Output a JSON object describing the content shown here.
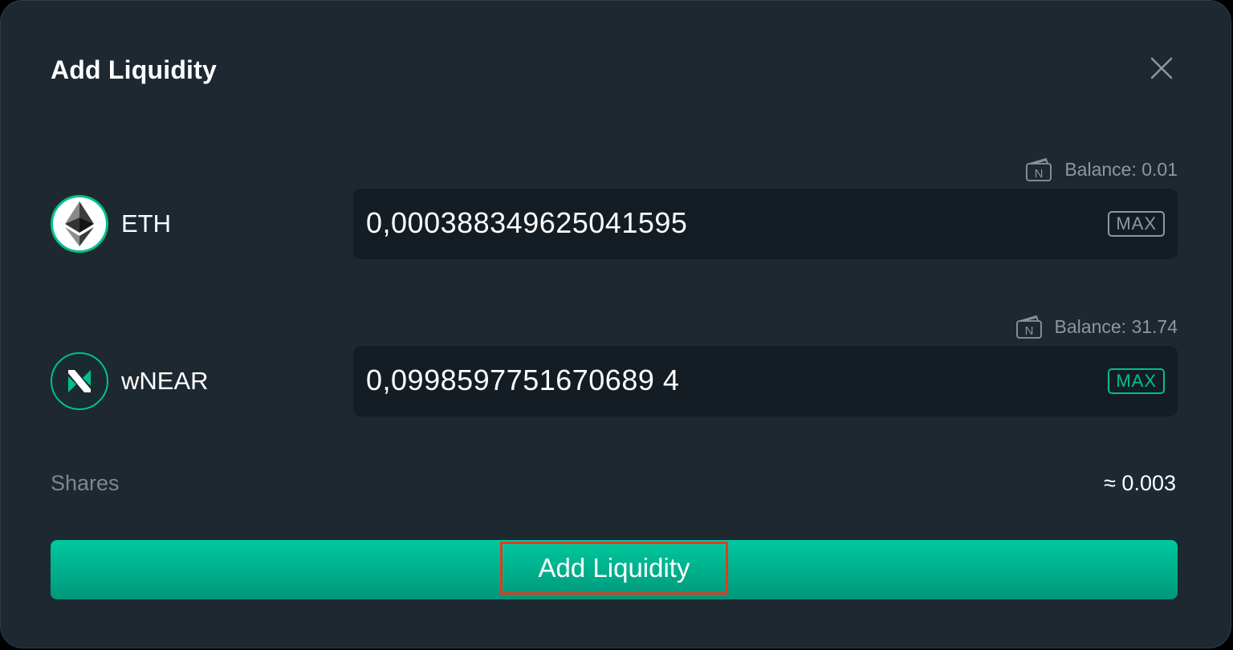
{
  "dialog": {
    "title": "Add Liquidity",
    "close_icon": "close-icon"
  },
  "tokens": [
    {
      "symbol": "ETH",
      "icon": "eth-logo-icon",
      "balance_label": "Balance: 0.01",
      "amount": "0,000388349625041595",
      "max_label": "MAX",
      "max_state": "inactive"
    },
    {
      "symbol": "wNEAR",
      "icon": "wnear-logo-icon",
      "balance_label": "Balance: 31.74",
      "amount": "0,0998597751670689 4",
      "max_label": "MAX",
      "max_state": "active"
    }
  ],
  "shares": {
    "label": "Shares",
    "value": "≈ 0.003"
  },
  "submit": {
    "label": "Add Liquidity"
  },
  "colors": {
    "background": "#1e2831",
    "input_bg": "#151d24",
    "accent": "#00c08b",
    "muted_text": "#8e979f",
    "highlight_border": "#e33a1f"
  }
}
